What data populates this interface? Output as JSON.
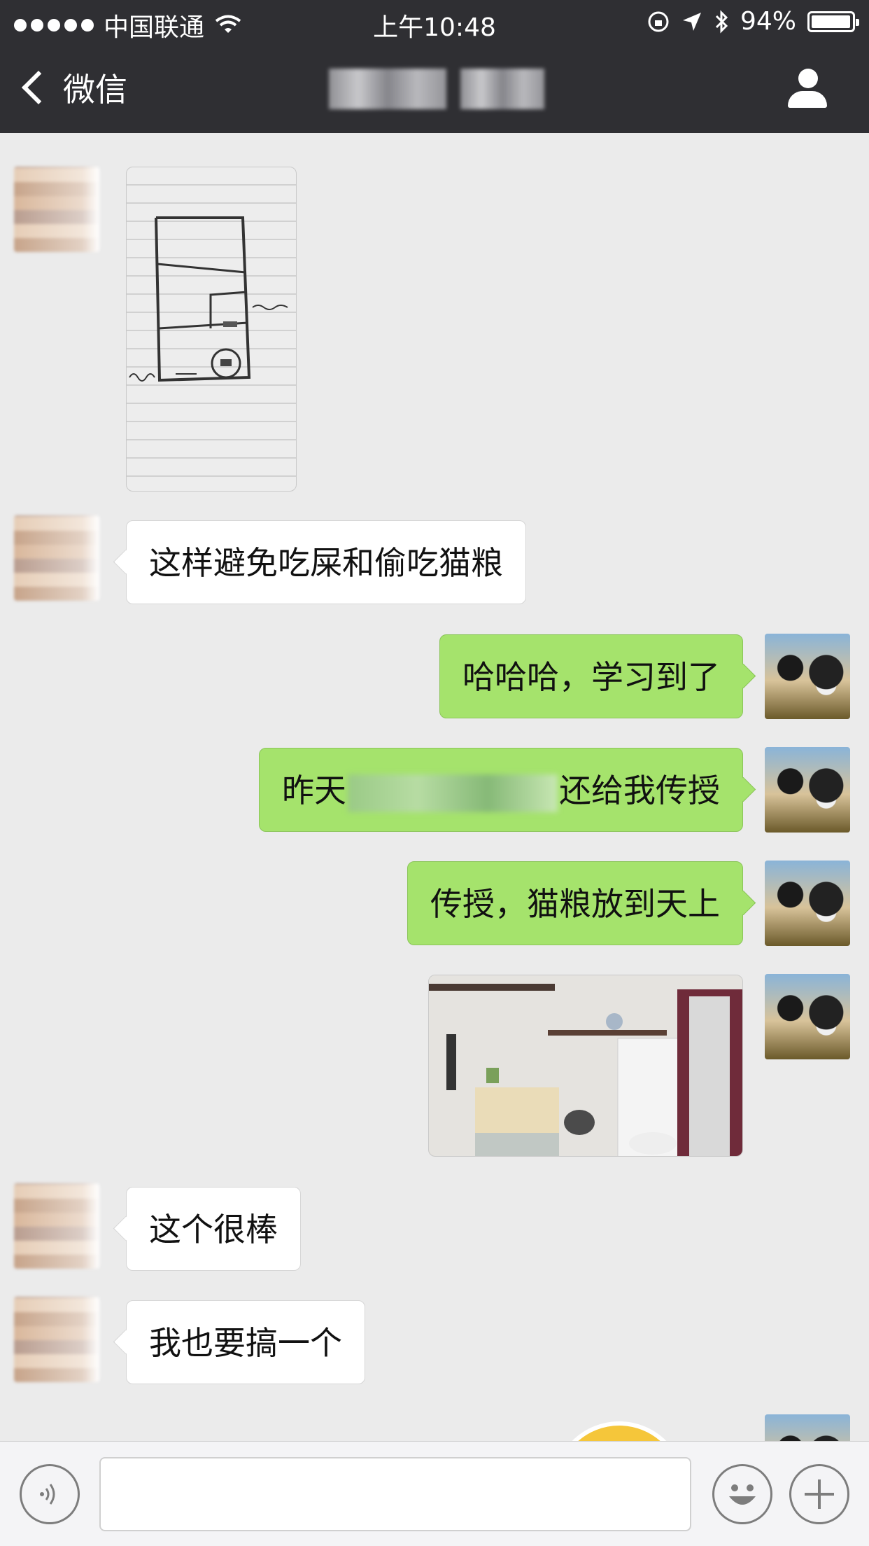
{
  "status_bar": {
    "carrier": "中国联通",
    "time": "上午10:48",
    "battery": "94%",
    "signal_dots": 5
  },
  "nav": {
    "back_label": "微信",
    "profile_icon": "person-icon"
  },
  "messages": [
    {
      "side": "left",
      "type": "image",
      "image": "hand-drawn-floor-sketch"
    },
    {
      "side": "left",
      "type": "text",
      "text": "这样避免吃屎和偷吃猫粮"
    },
    {
      "side": "right",
      "type": "text",
      "text": "哈哈哈，学习到了"
    },
    {
      "side": "right",
      "type": "text",
      "text_start": "昨天",
      "text_end": "还给我传授"
    },
    {
      "side": "right",
      "type": "text",
      "text": "传授，猫粮放到天上"
    },
    {
      "side": "right",
      "type": "image",
      "image": "room-photo"
    },
    {
      "side": "left",
      "type": "text",
      "text": "这个很棒"
    },
    {
      "side": "left",
      "type": "text",
      "text": "我也要搞一个"
    }
  ],
  "input_bar": {
    "voice_icon": "voice-icon",
    "emoji_icon": "emoji-icon",
    "plus_icon": "plus-icon",
    "placeholder": ""
  },
  "colors": {
    "nav_bg": "#2f2f33",
    "chat_bg": "#ebebeb",
    "my_bubble": "#a5e36c",
    "their_bubble": "#ffffff"
  }
}
